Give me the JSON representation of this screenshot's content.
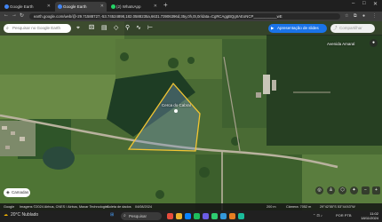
{
  "browser": {
    "tabs": [
      {
        "label": "Google Earth",
        "fav_color": "#4285f4"
      },
      {
        "label": "Google Earth",
        "fav_color": "#4285f4"
      },
      {
        "label": "(2) WhatsApp",
        "fav_color": "#25d366"
      }
    ],
    "url": "earth.google.com/web/@-29.71588727,-53.74524898,182.0588235a,6631.73906396d,35y,0h,0t,0r/data=CgRCAggBQgIIAEoNCP___________wE",
    "new_tab": "+",
    "window_controls": [
      "–",
      "□",
      "✕"
    ]
  },
  "earth": {
    "search_placeholder": "Pesquisar no Google Earth",
    "presentation_label": "Apresentação de slides",
    "share_label": "Compartilhar",
    "place_label": "Avenida Amaral",
    "area_label": "Cerca do Cabral",
    "layers_label": "Camadas",
    "status": {
      "google": "Google",
      "copyright": "Imagens ©2024 Airbus, CNES / Airbus, Maxar Technologies",
      "capture": "Coleta de dados",
      "date": "04/08/2024",
      "camera": "Câmera: 7052 m",
      "coords": "29°42'55\"S 53°44'43\"W",
      "scale": "200 m"
    }
  },
  "taskbar": {
    "weather": "20°C Nublado",
    "search_placeholder": "Pesquisar",
    "lang": "POR PTB",
    "time": "11:02",
    "date": "18/11/2024"
  },
  "colors": {
    "field_dark": "#1e3d24",
    "field_light": "#4f7a32",
    "polygon_stroke": "#f2c532",
    "road": "#b9b29e",
    "accent": "#1a73e8"
  }
}
